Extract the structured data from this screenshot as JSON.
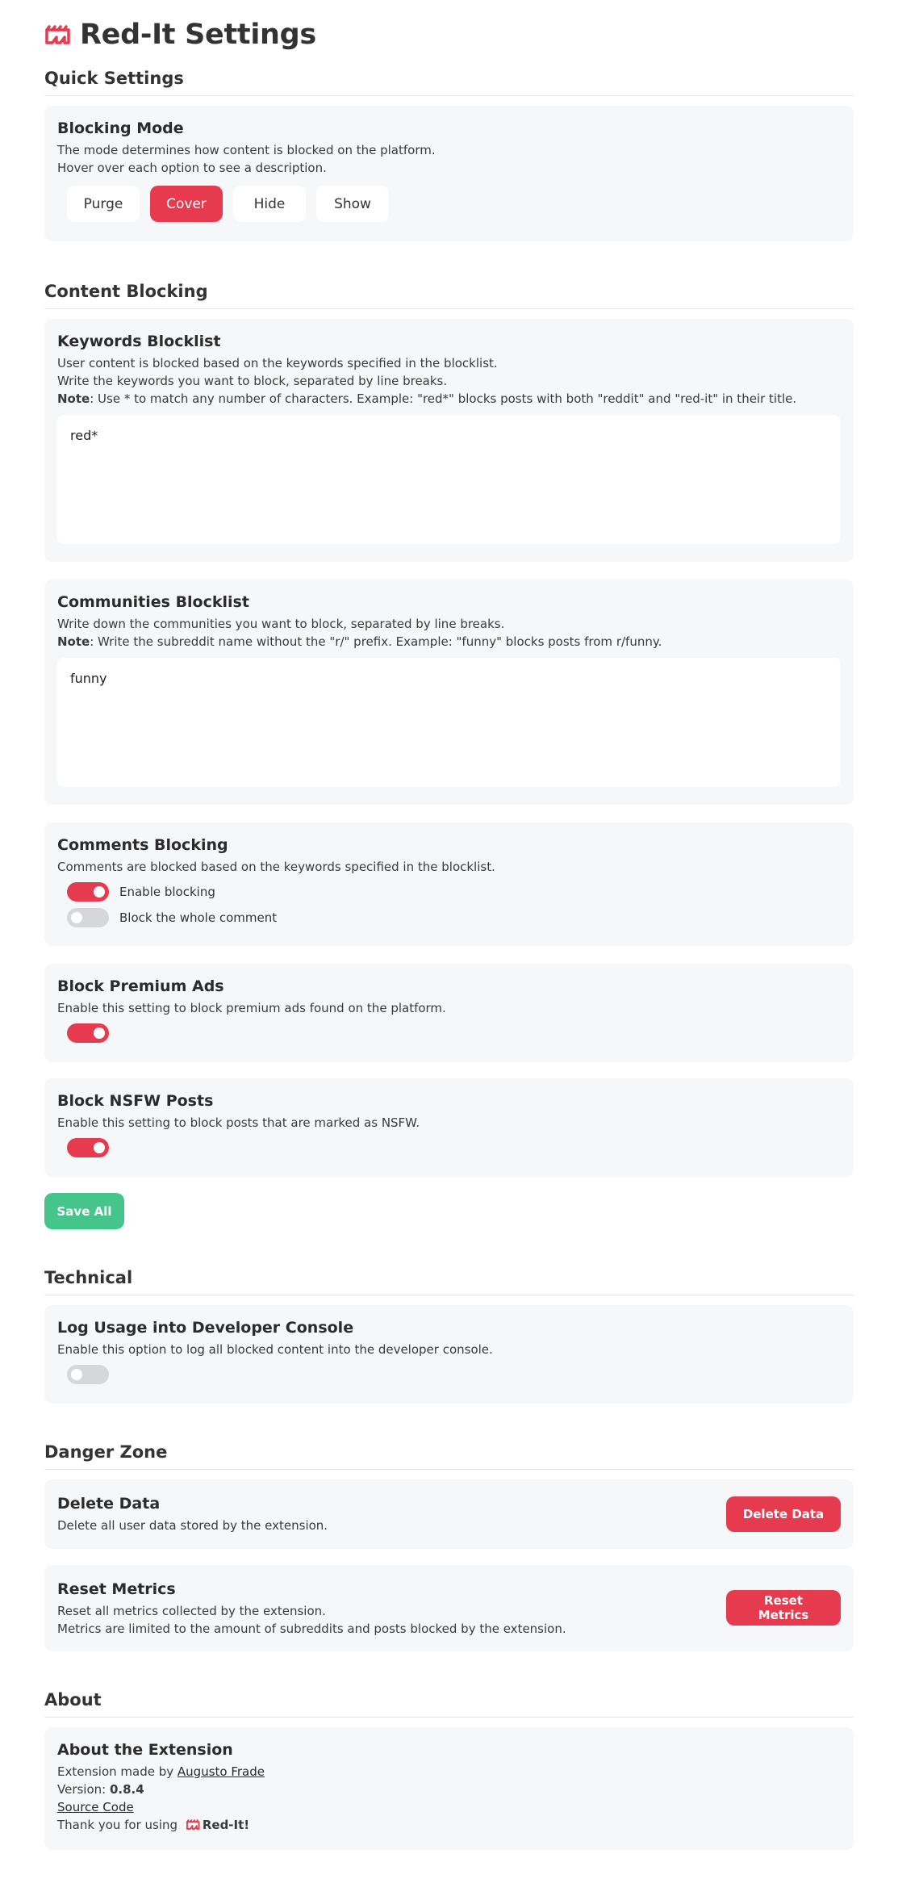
{
  "app": {
    "title": "Red-It Settings"
  },
  "quick_settings": {
    "title": "Quick Settings",
    "blocking_mode": {
      "title": "Blocking Mode",
      "desc_line1": "The mode determines how content is blocked on the platform.",
      "desc_line2": "Hover over each option to see a description.",
      "options": [
        "Purge",
        "Cover",
        "Hide",
        "Show"
      ],
      "selected": "Cover"
    }
  },
  "content_blocking": {
    "title": "Content Blocking",
    "keywords": {
      "title": "Keywords Blocklist",
      "desc_line1": "User content is blocked based on the keywords specified in the blocklist.",
      "desc_line2": "Write the keywords you want to block, separated by line breaks.",
      "note_label": "Note",
      "note_text": ": Use * to match any number of characters. Example: \"red*\" blocks posts with both \"reddit\" and \"red-it\" in their title.",
      "value": "red*"
    },
    "communities": {
      "title": "Communities Blocklist",
      "desc_line1": "Write down the communities you want to block, separated by line breaks.",
      "note_label": "Note",
      "note_text": ": Write the subreddit name without the \"r/\" prefix. Example: \"funny\" blocks posts from r/funny.",
      "value": "funny"
    },
    "comments": {
      "title": "Comments Blocking",
      "desc": "Comments are blocked based on the keywords specified in the blocklist.",
      "enable_label": "Enable blocking",
      "enable_on": true,
      "whole_label": "Block the whole comment",
      "whole_on": false
    },
    "premium_ads": {
      "title": "Block Premium Ads",
      "desc": "Enable this setting to block premium ads found on the platform.",
      "on": true
    },
    "nsfw": {
      "title": "Block NSFW Posts",
      "desc": "Enable this setting to block posts that are marked as NSFW.",
      "on": true
    },
    "save_label": "Save All"
  },
  "technical": {
    "title": "Technical",
    "log_usage": {
      "title": "Log Usage into Developer Console",
      "desc": "Enable this option to log all blocked content into the developer console.",
      "on": false
    }
  },
  "danger_zone": {
    "title": "Danger Zone",
    "delete": {
      "title": "Delete Data",
      "desc": "Delete all user data stored by the extension.",
      "button": "Delete Data"
    },
    "reset": {
      "title": "Reset Metrics",
      "desc_line1": "Reset all metrics collected by the extension.",
      "desc_line2": "Metrics are limited to the amount of subreddits and posts blocked by the extension.",
      "button": "Reset Metrics"
    }
  },
  "about": {
    "title": "About",
    "card_title": "About the Extension",
    "made_by_prefix": "Extension made by ",
    "author": "Augusto Frade",
    "version_prefix": "Version: ",
    "version": "0.8.4",
    "source_code": "Source Code",
    "thanks_prefix": "Thank you for using",
    "thanks_name": "Red-It!"
  },
  "colors": {
    "accent": "#e63a4f",
    "save": "#45c58b",
    "card_bg": "#f6f7f9",
    "toggle_off": "#d6d7d9"
  },
  "icons": {
    "logo": "red-it-logo-icon"
  }
}
